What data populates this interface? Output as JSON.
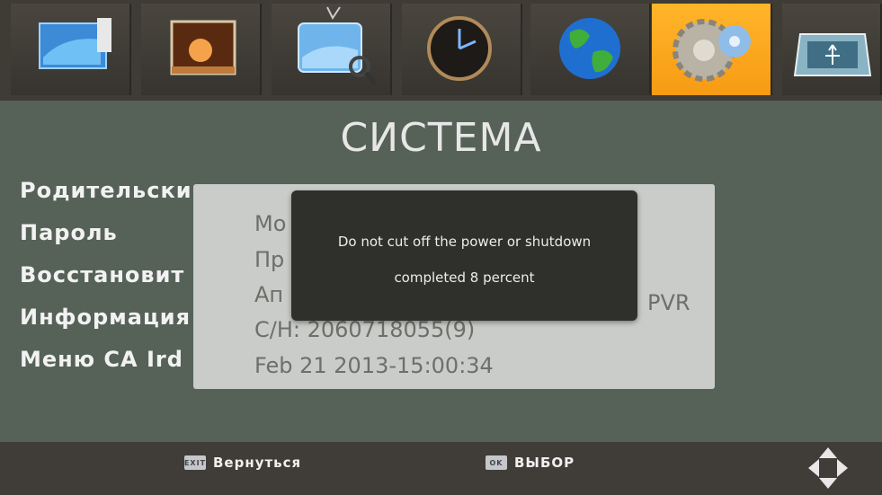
{
  "top_icons": [
    {
      "icon": "program-icon"
    },
    {
      "icon": "picture-icon"
    },
    {
      "icon": "channel-search-icon"
    },
    {
      "icon": "clock-icon"
    },
    {
      "icon": "globe-icon"
    },
    {
      "icon": "system-gear-icon",
      "active": true
    },
    {
      "icon": "usb-icon"
    }
  ],
  "page": {
    "title": "СИСТЕМА"
  },
  "menu": {
    "items": [
      {
        "label": "Родительски"
      },
      {
        "label": "Пароль"
      },
      {
        "label": "Восстановит"
      },
      {
        "label": "Информация"
      },
      {
        "label": "Меню CA Ird"
      }
    ]
  },
  "info_panel": {
    "lines": [
      "Мо",
      "Пр",
      "Ап",
      "C/H:     2060718055(9)",
      "Feb 21 2013-15:00:34"
    ],
    "right_text": "PVR"
  },
  "dialog": {
    "line1": "Do not cut off the power or shutdown",
    "line2": "completed  8 percent",
    "progress_percent": 8
  },
  "bottom_bar": {
    "back": {
      "key": "EXIT",
      "label": "Вернуться"
    },
    "select": {
      "key": "OK",
      "label": "ВЫБОР"
    }
  },
  "colors": {
    "accent": "#f7a21b",
    "background": "#566257",
    "panel": "#c9ccc8",
    "dialog": "#2f302c"
  }
}
